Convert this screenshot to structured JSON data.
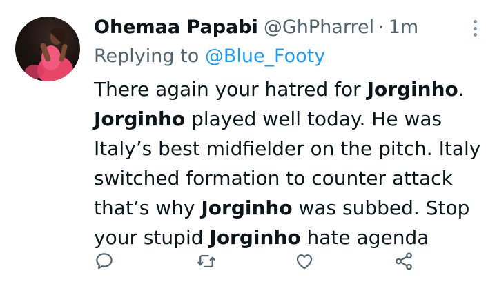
{
  "tweet": {
    "display_name": "Ohemaa Papabi",
    "handle": "@GhPharrel",
    "separator": "·",
    "timestamp": "1m",
    "reply_prefix": "Replying to",
    "reply_mention": "@Blue_Footy",
    "body": [
      {
        "text": "There again your hatred for ",
        "bold": false
      },
      {
        "text": "Jorginho",
        "bold": true
      },
      {
        "text": ". ",
        "bold": false
      },
      {
        "text": "Jorginho",
        "bold": true
      },
      {
        "text": " played well today. He was Italy’s best midfielder on the pitch. Italy switched formation to counter attack that’s why ",
        "bold": false
      },
      {
        "text": "Jorginho",
        "bold": true
      },
      {
        "text": " was subbed. Stop your stupid ",
        "bold": false
      },
      {
        "text": "Jorginho",
        "bold": true
      },
      {
        "text": " hate agenda",
        "bold": false
      }
    ]
  },
  "actions": {
    "reply_icon": "comment-bubble-icon",
    "retweet_icon": "retweet-icon",
    "like_icon": "heart-icon",
    "share_icon": "share-icon"
  },
  "colors": {
    "text": "#0f1419",
    "secondary": "#536471",
    "mention": "#1d9bf0",
    "icon": "#536471"
  }
}
